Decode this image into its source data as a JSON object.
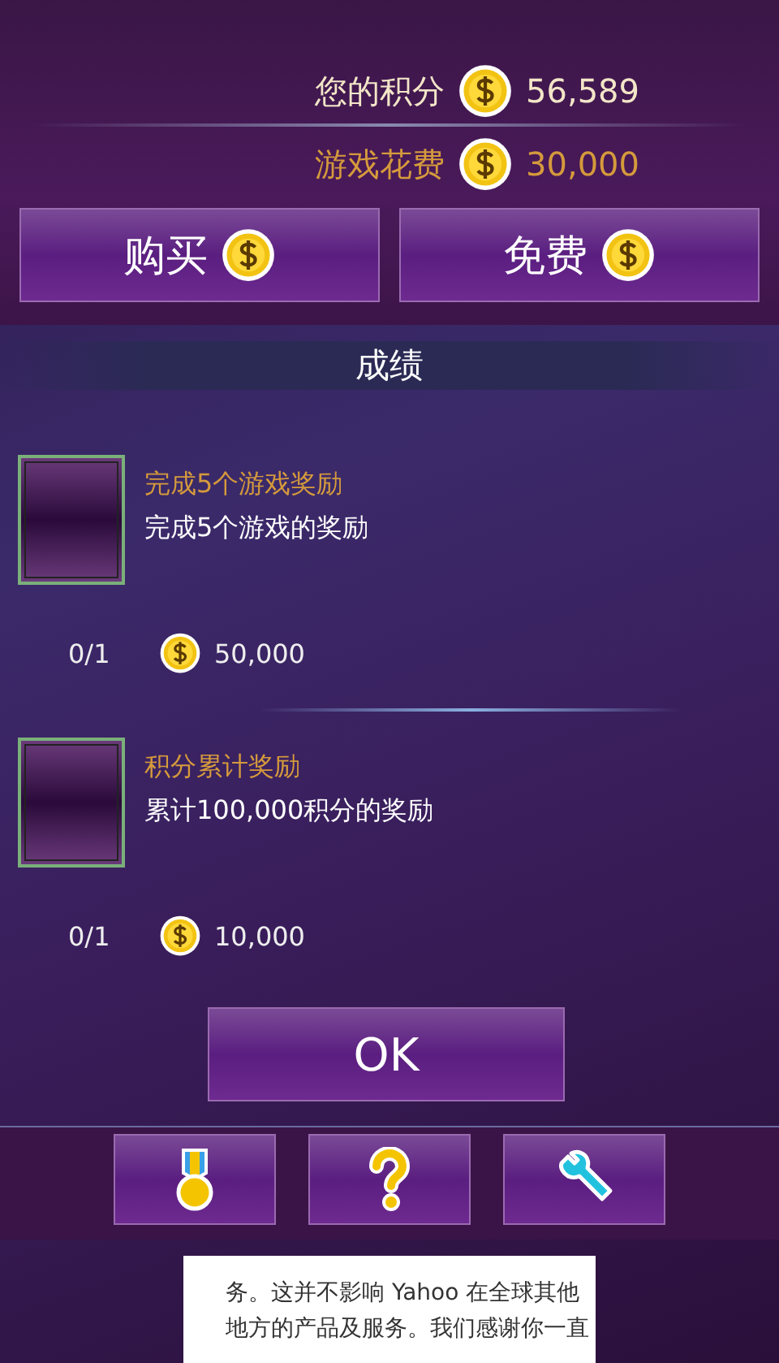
{
  "score": {
    "label": "您的积分",
    "value": "56,589"
  },
  "cost": {
    "label": "游戏花费",
    "value": "30,000"
  },
  "buttons": [
    {
      "label": "购买"
    },
    {
      "label": "免费"
    }
  ],
  "section_title": "成绩",
  "achievements": [
    {
      "title": "完成5个游戏奖励",
      "description": "完成5个游戏的奖励",
      "progress": "0/1",
      "reward": "50,000"
    },
    {
      "title": "积分累计奖励",
      "description": "累计100,000积分的奖励",
      "progress": "0/1",
      "reward": "10,000"
    }
  ],
  "ok_button": "OK",
  "toolbar": [
    {
      "kind": "medal"
    },
    {
      "kind": "help"
    },
    {
      "kind": "wrench"
    }
  ],
  "notice": {
    "lines": [
      "务。这并不影响 Yahoo 在全球其他",
      "地方的产品及服务。我们感谢你一直"
    ]
  }
}
